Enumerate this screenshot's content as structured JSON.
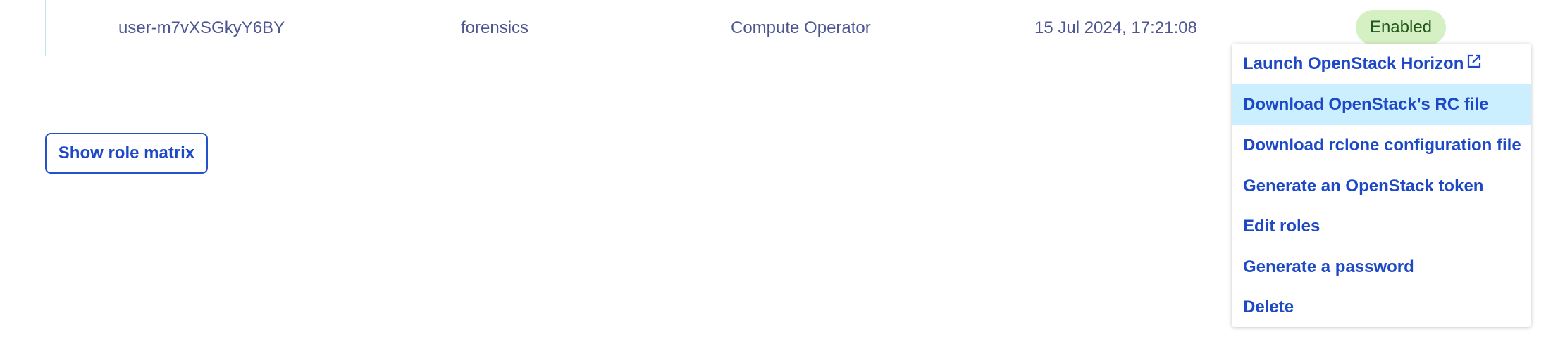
{
  "row": {
    "username": "user-m7vXSGkyY6BY",
    "description": "forensics",
    "role": "Compute Operator",
    "created": "15 Jul 2024, 17:21:08",
    "status": "Enabled"
  },
  "actions": {
    "role_matrix_label": "Show role matrix",
    "more_icon": "ellipsis-icon"
  },
  "menu": {
    "items": [
      {
        "label": "Launch OpenStack Horizon",
        "icon": "external-link-icon"
      },
      {
        "label": "Download OpenStack's RC file",
        "active": true
      },
      {
        "label": "Download rclone configuration file"
      },
      {
        "label": "Generate an OpenStack token"
      },
      {
        "label": "Edit roles"
      },
      {
        "label": "Generate a password"
      },
      {
        "label": "Delete"
      }
    ]
  },
  "colors": {
    "accent": "#2352cc",
    "link": "#1d49c6",
    "row_text": "#4d5693",
    "badge_bg": "#d5f0c2",
    "badge_text": "#21571a",
    "active_item_bg": "#ccefff",
    "row_border": "#bfe3ef"
  }
}
